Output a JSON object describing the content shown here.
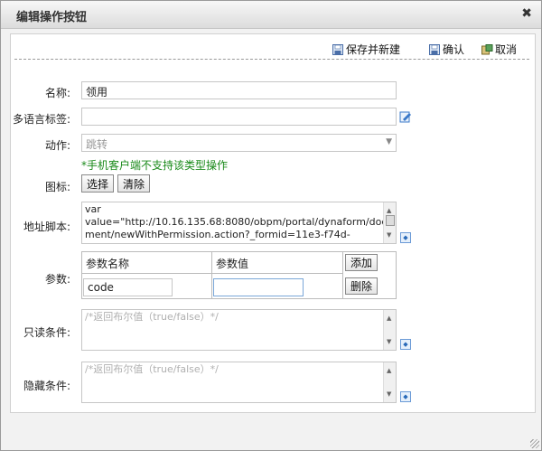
{
  "dialog": {
    "title": "编辑操作按钮",
    "close_glyph": "✖"
  },
  "toolbar": {
    "save_new_label": "保存并新建",
    "confirm_label": "确认",
    "cancel_label": "取消"
  },
  "form": {
    "name": {
      "label": "名称:",
      "value": "领用"
    },
    "i18n_label": {
      "label": "多语言标签:",
      "value": ""
    },
    "action": {
      "label": "动作:",
      "value": "跳转"
    },
    "mobile_note": "*手机客户端不支持该类型操作",
    "icon": {
      "label": "图标:",
      "select_label": "选择",
      "clear_label": "清除"
    },
    "url_script": {
      "label": "地址脚本:",
      "line1": "var",
      "line2": "value=\"http://10.16.135.68:8080/obpm/portal/dynaform/docu",
      "line3": "ment/newWithPermission.action?_formid=11e3-f74d-"
    },
    "params": {
      "label": "参数:",
      "col_name": "参数名称",
      "col_value": "参数值",
      "add_label": "添加",
      "delete_label": "删除",
      "rows": [
        {
          "name": "code",
          "value": ""
        }
      ]
    },
    "readonly_condition": {
      "label": "只读条件:",
      "placeholder": "/*返回布尔值（true/false）*/"
    },
    "hidden_condition": {
      "label": "隐藏条件:",
      "placeholder": "/*返回布尔值（true/false）*/"
    }
  },
  "icons": {
    "close": "close-icon",
    "save_new": "floppy-disk-icon",
    "confirm": "floppy-disk-icon",
    "cancel": "cancel-icon",
    "i18n": "edit-label-icon",
    "expand": "expand-icon"
  },
  "colors": {
    "note": "#1a8a1a",
    "accent_blue": "#2a6ab8"
  }
}
